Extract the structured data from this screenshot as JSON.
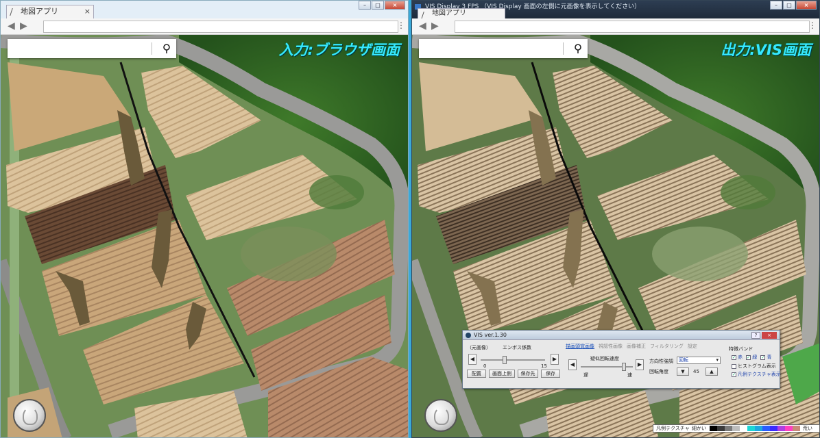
{
  "left_window": {
    "tab_label": "地図アプリ",
    "tab_close": "×",
    "caption": "入力:ブラウザ画面"
  },
  "right_window": {
    "title": "VIS Display  3 FPS  （VIS Display 画面の左側に元画像を表示してください）",
    "tab_label": "地図アプリ",
    "caption": "出力:VIS画面"
  },
  "vis_panel": {
    "title": "VIS ver.1.30",
    "help": "?",
    "close": "×",
    "source_label": "（元画像）",
    "emboss_label": "エンボス係数",
    "slider_min": "0",
    "slider_max": "15",
    "buttons": [
      "配置",
      "画面上側",
      "保存先",
      "保存"
    ],
    "tabs": [
      "描画頭覚画像",
      "視認性画像",
      "画像補正",
      "フィルタリング",
      "設定"
    ],
    "rotation_speed_label": "疑似回転速度",
    "slow": "遅",
    "fast": "速",
    "direction_label": "方向性強調",
    "direction_value": "回転",
    "angle_label": "回転角度",
    "angle_value": "45",
    "band_label": "特徴バンド",
    "bands": [
      "赤",
      "緑",
      "青"
    ],
    "histogram_label": "ヒストグラム表示",
    "legend_texture_label": "凡例テクスチャ表示"
  },
  "legend_bar": {
    "label": "凡例テクスチャ",
    "fine": "細かい",
    "coarse": "荒い",
    "colors": [
      "#000000",
      "#3a3a3a",
      "#7a7a7a",
      "#bdbdbd",
      "#ffffff",
      "#1dd6d6",
      "#1fa8e0",
      "#2a5cff",
      "#3a2aff",
      "#b040e0",
      "#ff40c0",
      "#c88a7a"
    ]
  }
}
